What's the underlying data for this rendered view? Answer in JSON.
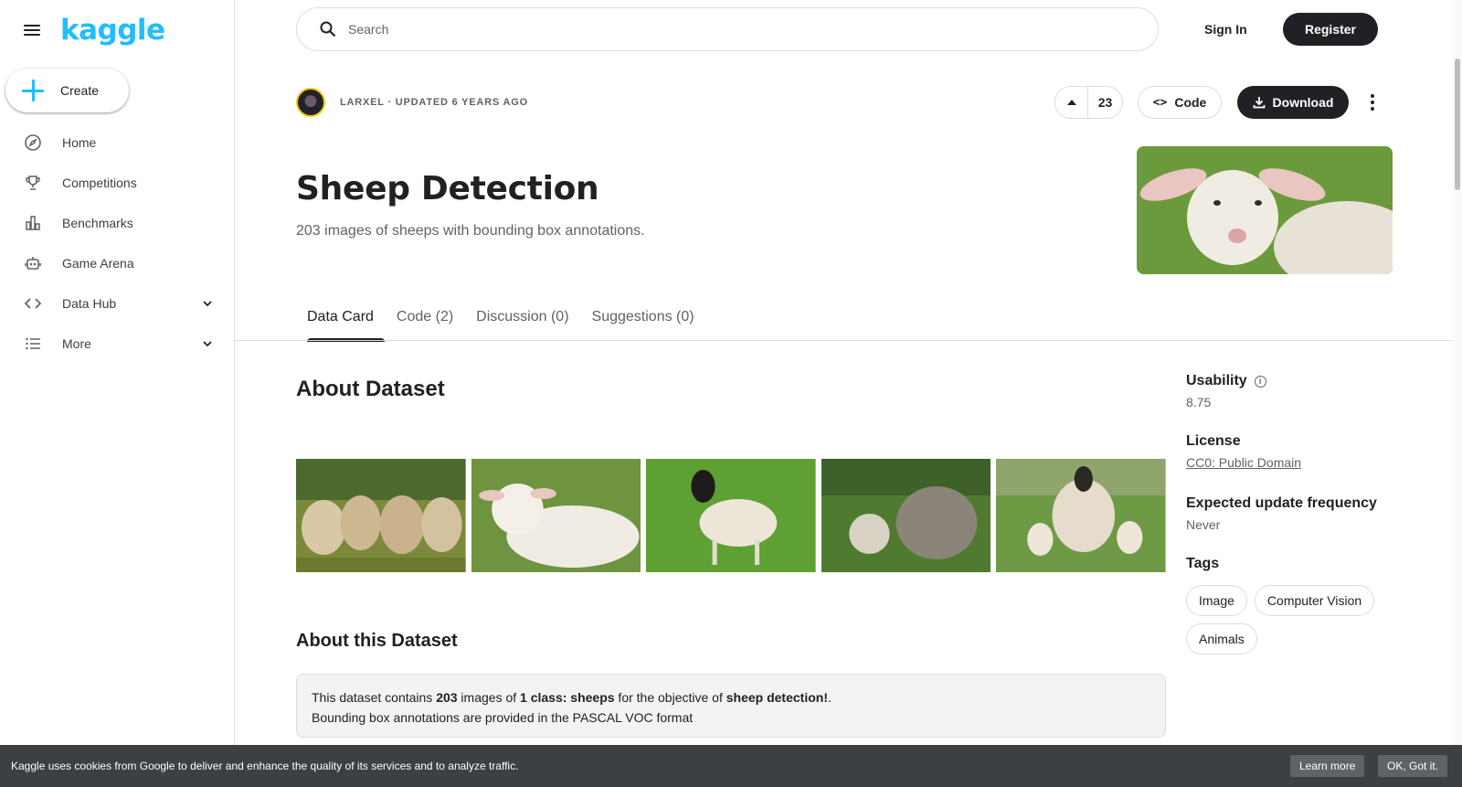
{
  "app": {
    "logo_text": "kaggle",
    "brand_color": "#20beff"
  },
  "sidebar": {
    "create_label": "Create",
    "items": [
      {
        "label": "Home",
        "icon": "compass-icon"
      },
      {
        "label": "Competitions",
        "icon": "trophy-icon"
      },
      {
        "label": "Benchmarks",
        "icon": "bar-chart-icon"
      },
      {
        "label": "Game Arena",
        "icon": "robot-icon"
      },
      {
        "label": "Data Hub",
        "icon": "code-brackets-icon",
        "expandable": true
      },
      {
        "label": "More",
        "icon": "list-icon",
        "expandable": true
      }
    ]
  },
  "header": {
    "search_placeholder": "Search",
    "signin_label": "Sign In",
    "register_label": "Register"
  },
  "dataset": {
    "owner_line": "LARXEL · UPDATED 6 YEARS AGO",
    "votes": "23",
    "code_label": "Code",
    "download_label": "Download",
    "title": "Sheep Detection",
    "subtitle": "203 images of sheeps with bounding box annotations."
  },
  "tabs": [
    {
      "label": "Data Card",
      "active": true
    },
    {
      "label": "Code (2)",
      "active": false
    },
    {
      "label": "Discussion (0)",
      "active": false
    },
    {
      "label": "Suggestions (0)",
      "active": false
    }
  ],
  "content": {
    "about_title": "About Dataset",
    "about_sub_title": "About this Dataset",
    "notice": {
      "p1_a": "This dataset contains ",
      "p1_b": "203",
      "p1_c": " images of ",
      "p1_d": "1 class: sheeps",
      "p1_e": " for the objective of ",
      "p1_f": "sheep detection!",
      "p1_g": ".",
      "p2": "Bounding box annotations are provided in the PASCAL VOC format"
    }
  },
  "side": {
    "usability_label": "Usability",
    "usability_value": "8.75",
    "license_label": "License",
    "license_value": "CC0: Public Domain",
    "update_label": "Expected update frequency",
    "update_value": "Never",
    "tags_label": "Tags",
    "tags": [
      "Image",
      "Computer Vision",
      "Animals"
    ]
  },
  "cookie": {
    "text": "Kaggle uses cookies from Google to deliver and enhance the quality of its services and to analyze traffic.",
    "learn_more": "Learn more",
    "ok": "OK, Got it."
  }
}
